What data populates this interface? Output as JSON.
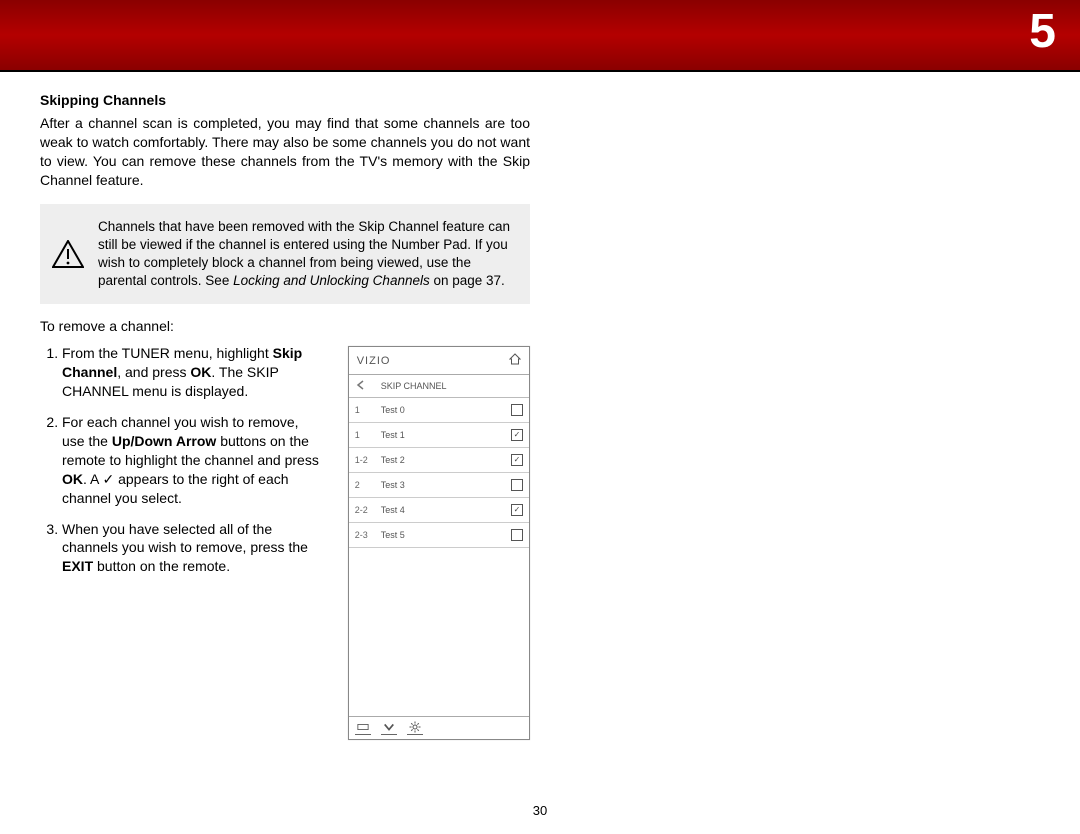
{
  "chapter_number": "5",
  "heading": "Skipping Channels",
  "intro": "After a channel scan is completed, you may find that some channels are too weak to watch comfortably. There may also be some channels you do not want to view. You can remove these channels from the TV's memory with the Skip Channel feature.",
  "note": {
    "text_a": "Channels that have been removed with the Skip Channel feature can still be viewed if the channel is entered using the Number Pad. If you wish to completely block a channel from being viewed, use the parental controls. See ",
    "italic": "Locking and Unlocking Channels",
    "text_b": " on page 37."
  },
  "lead": "To remove a channel:",
  "steps": {
    "s1a": "From the TUNER menu, highlight ",
    "s1b_bold": "Skip Channel",
    "s1c": ", and press ",
    "s1d_bold": "OK",
    "s1e": ". The SKIP CHANNEL menu is displayed.",
    "s2a": "For each channel you wish to remove, use the ",
    "s2b_bold": "Up/Down Arrow",
    "s2c": " buttons on the remote to highlight the channel and press ",
    "s2d_bold": "OK",
    "s2e": ". A ✓ appears to the right of each channel you select.",
    "s3a": "When you have selected all of the channels you wish to remove, press the ",
    "s3b_bold": "EXIT",
    "s3c": " button on the remote."
  },
  "tv": {
    "brand": "VIZIO",
    "title": "SKIP CHANNEL",
    "rows": [
      {
        "num": "1",
        "name": "Test 0",
        "checked": false
      },
      {
        "num": "1",
        "name": "Test 1",
        "checked": true
      },
      {
        "num": "1-2",
        "name": "Test 2",
        "checked": true
      },
      {
        "num": "2",
        "name": "Test 3",
        "checked": false
      },
      {
        "num": "2-2",
        "name": "Test 4",
        "checked": true
      },
      {
        "num": "2-3",
        "name": "Test 5",
        "checked": false
      }
    ]
  },
  "page_number": "30"
}
